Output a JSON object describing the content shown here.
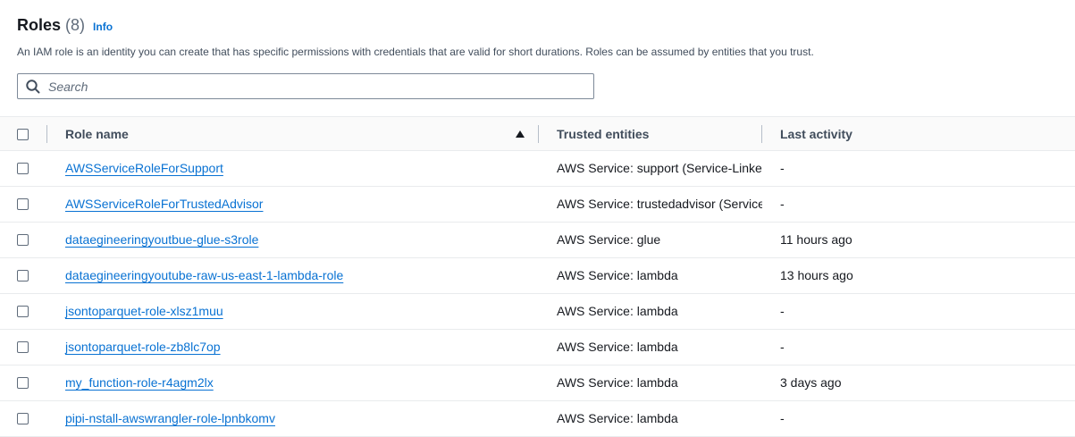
{
  "header": {
    "title": "Roles",
    "count": "(8)",
    "info_link": "Info",
    "description": "An IAM role is an identity you can create that has specific permissions with credentials that are valid for short durations. Roles can be assumed by entities that you trust."
  },
  "search": {
    "placeholder": "Search",
    "value": ""
  },
  "table": {
    "columns": {
      "role_name": "Role name",
      "trusted_entities": "Trusted entities",
      "last_activity": "Last activity"
    },
    "sort": {
      "column": "Role name",
      "direction": "ascending"
    },
    "rows": [
      {
        "name": "AWSServiceRoleForSupport",
        "trusted": "AWS Service: support ",
        "trusted_link": "(Service-Linked",
        "last": "-"
      },
      {
        "name": "AWSServiceRoleForTrustedAdvisor",
        "trusted": "AWS Service: trustedadvisor ",
        "trusted_link": "(Service-",
        "last": "-"
      },
      {
        "name": "dataegineeringyoutbue-glue-s3role",
        "trusted": "AWS Service: glue",
        "trusted_link": "",
        "last": "11 hours ago"
      },
      {
        "name": "dataegineeringyoutube-raw-us-east-1-lambda-role",
        "trusted": "AWS Service: lambda",
        "trusted_link": "",
        "last": "13 hours ago"
      },
      {
        "name": "jsontoparquet-role-xlsz1muu",
        "trusted": "AWS Service: lambda",
        "trusted_link": "",
        "last": "-"
      },
      {
        "name": "jsontoparquet-role-zb8lc7op",
        "trusted": "AWS Service: lambda",
        "trusted_link": "",
        "last": "-"
      },
      {
        "name": "my_function-role-r4agm2lx",
        "trusted": "AWS Service: lambda",
        "trusted_link": "",
        "last": "3 days ago"
      },
      {
        "name": "pipi-nstall-awswrangler-role-lpnbkomv",
        "trusted": "AWS Service: lambda",
        "trusted_link": "",
        "last": "-"
      }
    ]
  }
}
